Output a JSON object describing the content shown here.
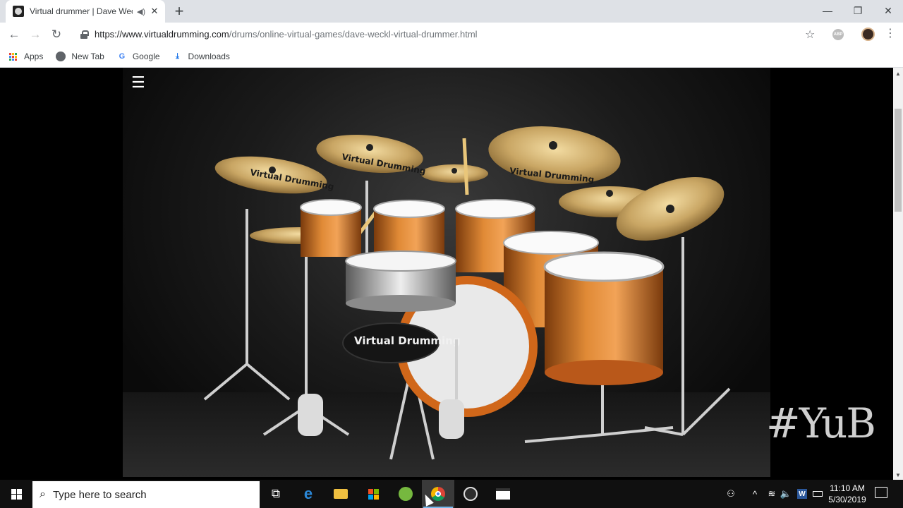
{
  "browser": {
    "tab": {
      "title": "Virtual drummer | Dave Weckl Virtual Drummer",
      "audio_icon": "speaker-icon",
      "close_glyph": "✕"
    },
    "new_tab_glyph": "+",
    "window_controls": {
      "minimize": "—",
      "restore": "❐",
      "close": "✕"
    },
    "nav": {
      "back": "←",
      "forward": "→",
      "reload": "↻"
    },
    "url": {
      "host": "https://www.virtualdrumming.com",
      "path": "/drums/online-virtual-games/dave-weckl-virtual-drummer.html"
    },
    "star_glyph": "☆",
    "abp_label": "ABP",
    "menu_glyph": "⋮",
    "bookmarks": [
      {
        "label": "Apps",
        "icon": "apps-grid-icon"
      },
      {
        "label": "New Tab",
        "icon": "globe-icon"
      },
      {
        "label": "Google",
        "icon": "google-icon"
      },
      {
        "label": "Downloads",
        "icon": "download-icon"
      }
    ]
  },
  "page": {
    "menu_glyph": "☰",
    "drum_kit": {
      "brand_text": "Virtual Drumming"
    },
    "watermark": "#YuB"
  },
  "taskbar": {
    "search_placeholder": "Type here to search",
    "apps": [
      "task-view-icon",
      "edge-icon",
      "file-explorer-icon",
      "store-icon",
      "utorrent-icon",
      "chrome-icon",
      "obs-icon",
      "media-clapper-icon"
    ],
    "active_app": "chrome-icon",
    "clock": {
      "time": "11:10 AM",
      "date": "5/30/2019"
    },
    "tray_glyphs": {
      "people": "⚇",
      "chevron": "^",
      "volume": "🔈",
      "wifi": "≋",
      "w": "W"
    }
  },
  "colors": {
    "chrome_tab_bg": "#dee1e6",
    "taskbar_bg": "#101010",
    "cymbal_gold": "#c9a664",
    "drum_orange": "#c8671e"
  }
}
